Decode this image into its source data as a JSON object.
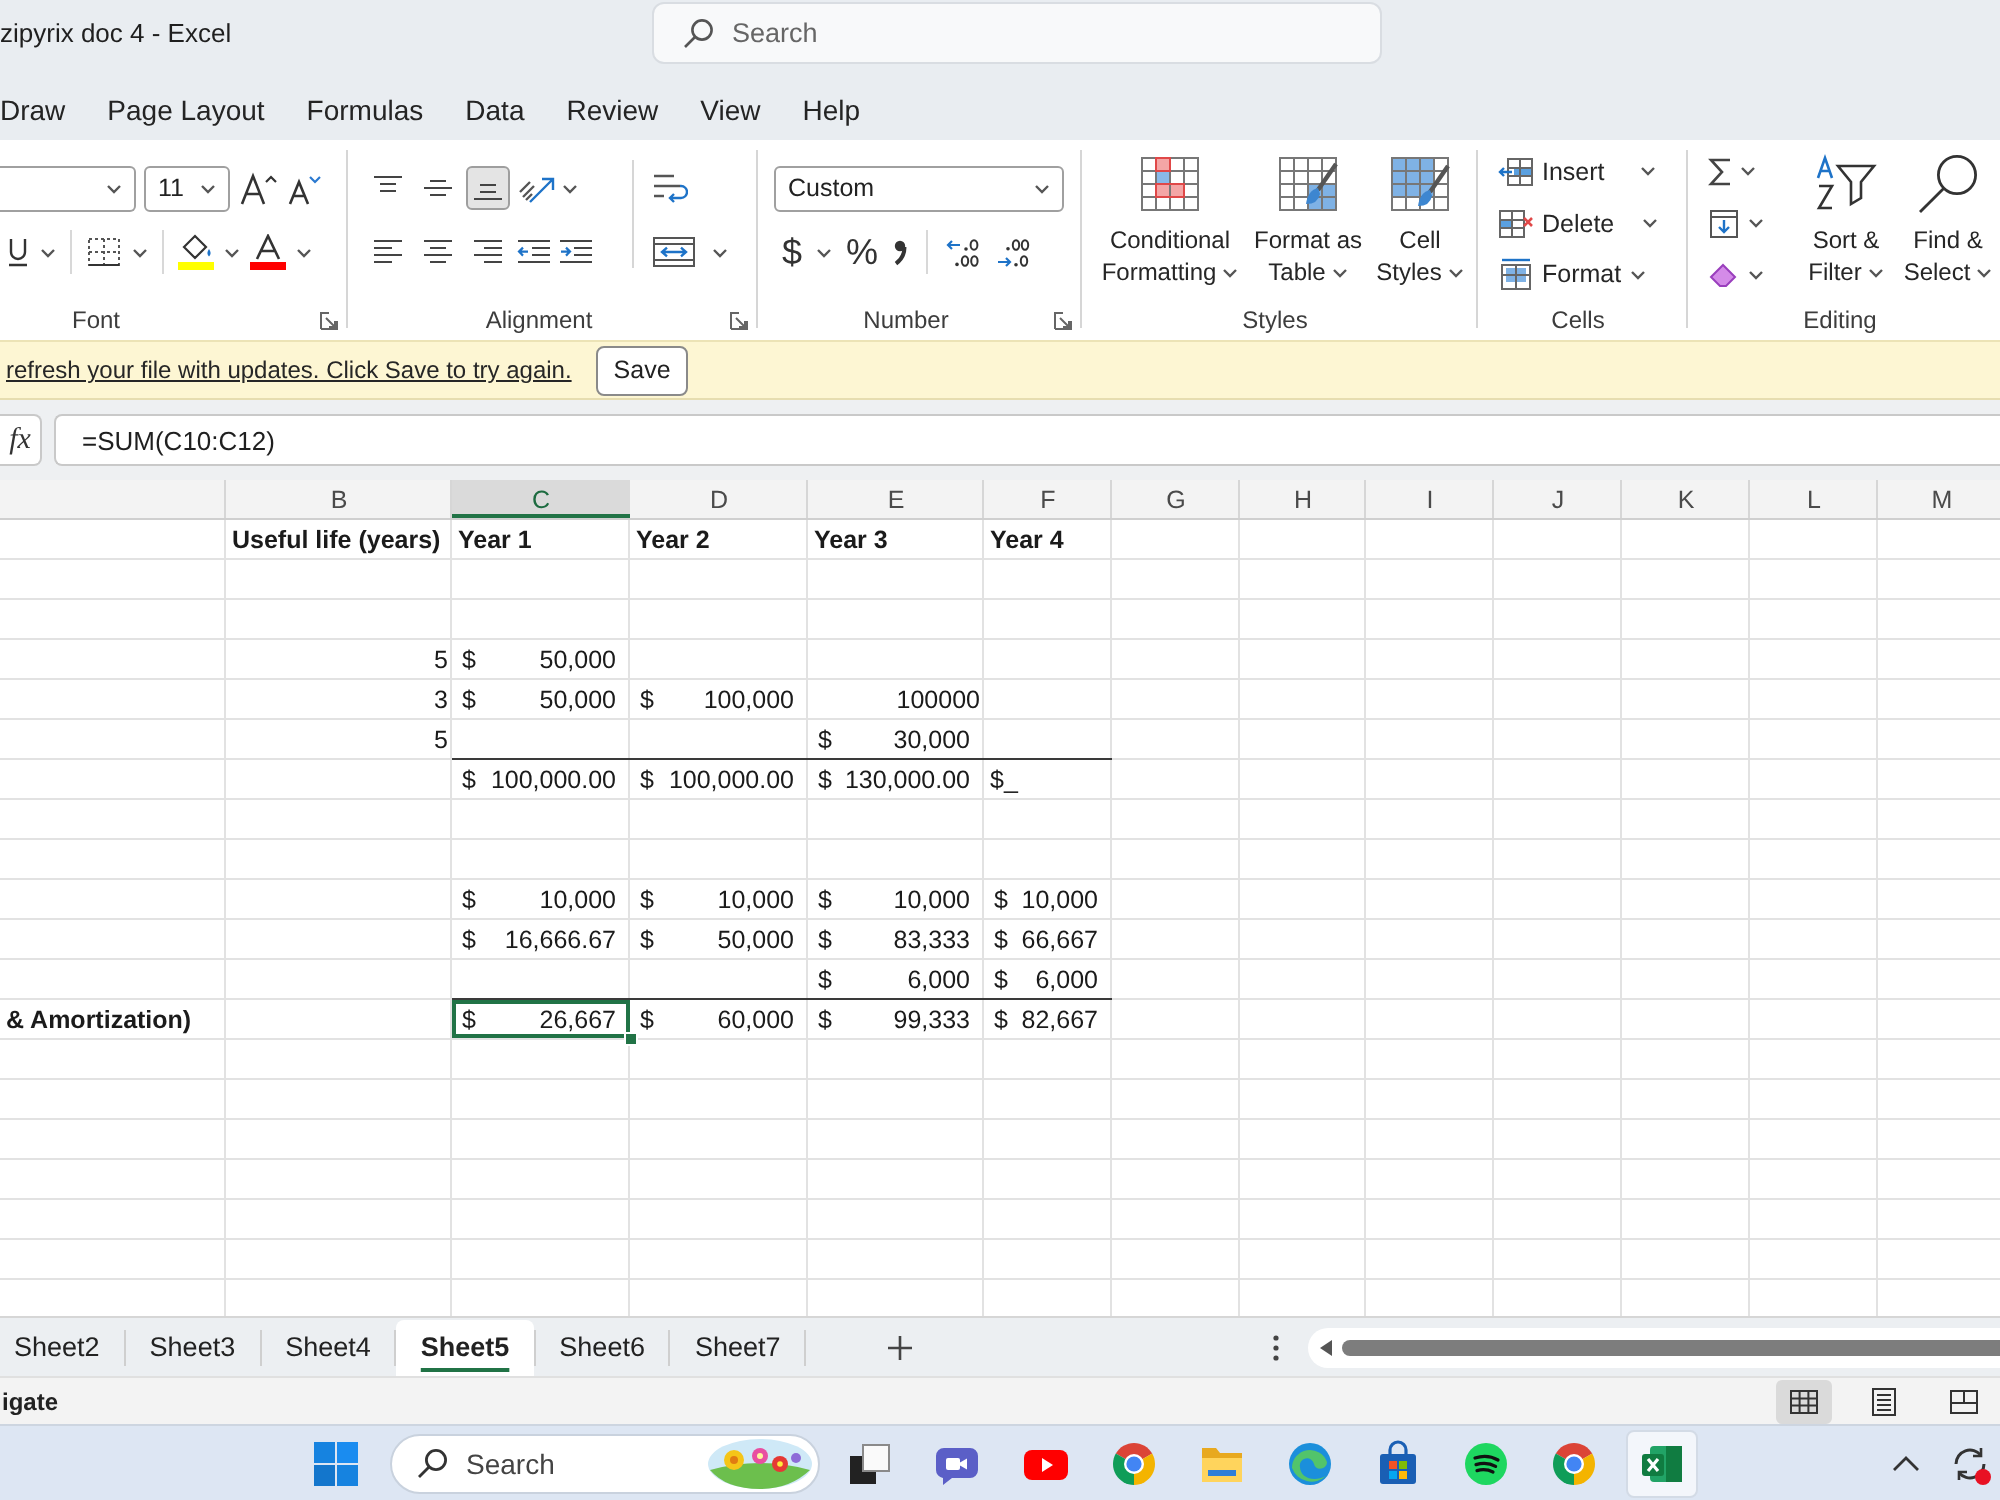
{
  "title_bar": {
    "title": "zipyrix doc 4 - Excel",
    "search": {
      "placeholder": "Search"
    }
  },
  "ribbon_tabs": [
    "Draw",
    "Page Layout",
    "Formulas",
    "Data",
    "Review",
    "View",
    "Help"
  ],
  "ribbon": {
    "font": {
      "label": "Font",
      "size": "11",
      "colors": [
        {
          "kind": "fill",
          "color": "#ffff00"
        },
        {
          "kind": "text",
          "color": "#ff0000"
        }
      ]
    },
    "alignment": {
      "label": "Alignment",
      "vertical": [
        {
          "kind": "top",
          "selected": false
        },
        {
          "kind": "middle",
          "selected": false
        },
        {
          "kind": "bottom",
          "selected": true
        }
      ],
      "horizontal": [
        {
          "kind": "left",
          "selected": false
        },
        {
          "kind": "center",
          "selected": false
        },
        {
          "kind": "right",
          "selected": false
        }
      ]
    },
    "number": {
      "label": "Number",
      "format": "Custom",
      "currency": "$",
      "percent": "%"
    },
    "styles": {
      "label": "Styles",
      "buttons": [
        {
          "kind": "conditional",
          "label": "Conditional Formatting"
        },
        {
          "kind": "table",
          "label": "Format as Table"
        },
        {
          "kind": "cell_styles",
          "label": "Cell Styles"
        }
      ]
    },
    "cells": {
      "label": "Cells",
      "buttons": [
        {
          "kind": "insert",
          "label": "Insert"
        },
        {
          "kind": "delete",
          "label": "Delete"
        },
        {
          "kind": "format",
          "label": "Format"
        }
      ]
    },
    "editing": {
      "label": "Editing",
      "buttons": [
        {
          "kind": "sort",
          "label": "Sort & Filter"
        },
        {
          "kind": "find",
          "label": "Find & Select"
        }
      ]
    }
  },
  "message_bar": {
    "text": "refresh your file with updates. Click Save to try again.",
    "button": "Save"
  },
  "formula_bar": {
    "function_button": "fx",
    "formula": "=SUM(C10:C12)"
  },
  "sheet": {
    "columns": [
      {
        "label": "B",
        "selected": false
      },
      {
        "label": "C",
        "selected": true
      },
      {
        "label": "D",
        "selected": false
      },
      {
        "label": "E",
        "selected": false
      },
      {
        "label": "F",
        "selected": false
      },
      {
        "label": "G",
        "selected": false
      },
      {
        "label": "H",
        "selected": false
      },
      {
        "label": "I",
        "selected": false
      },
      {
        "label": "J",
        "selected": false
      },
      {
        "label": "K",
        "selected": false
      },
      {
        "label": "L",
        "selected": false
      },
      {
        "label": "M",
        "selected": false
      }
    ],
    "rows": [
      {
        "rule_below": false,
        "cells": [
          {
            "selected": false
          },
          {
            "kind": "heading",
            "text": "Useful life (years)",
            "selected": false
          },
          {
            "kind": "heading",
            "text": "Year 1",
            "selected": false
          },
          {
            "kind": "heading",
            "text": "Year 2",
            "selected": false
          },
          {
            "kind": "heading",
            "text": "Year 3",
            "selected": false
          },
          {
            "kind": "heading",
            "text": "Year 4",
            "selected": false
          }
        ]
      },
      {
        "rule_below": false
      },
      {
        "rule_below": false
      },
      {
        "rule_below": false,
        "cells": [
          {
            "selected": false
          },
          {
            "kind": "number",
            "text": "5",
            "selected": false
          },
          {
            "kind": "accounting",
            "currency": "$",
            "amount": "50,000",
            "selected": false
          },
          {
            "selected": false
          },
          {
            "selected": false
          },
          {
            "selected": false
          }
        ]
      },
      {
        "rule_below": false,
        "cells": [
          {
            "selected": false
          },
          {
            "kind": "number",
            "text": "3",
            "selected": false
          },
          {
            "kind": "accounting",
            "currency": "$",
            "amount": "50,000",
            "selected": false
          },
          {
            "kind": "accounting",
            "currency": "$",
            "amount": "100,000",
            "selected": false
          },
          {
            "kind": "number",
            "text": "100000",
            "selected": false
          },
          {
            "selected": false
          }
        ]
      },
      {
        "rule_below": true,
        "cells": [
          {
            "selected": false
          },
          {
            "kind": "number",
            "text": "5",
            "selected": false
          },
          {
            "selected": false
          },
          {
            "selected": false
          },
          {
            "kind": "accounting",
            "currency": "$",
            "amount": "30,000",
            "selected": false
          },
          {
            "selected": false
          }
        ]
      },
      {
        "rule_below": false,
        "cells": [
          {
            "selected": false
          },
          {
            "selected": false
          },
          {
            "kind": "accounting",
            "currency": "$",
            "amount": "100,000.00",
            "selected": false
          },
          {
            "kind": "accounting",
            "currency": "$",
            "amount": "100,000.00",
            "selected": false
          },
          {
            "kind": "accounting",
            "currency": "$",
            "amount": "130,000.00",
            "selected": false
          },
          {
            "kind": "text",
            "text": "$_",
            "selected": false
          }
        ]
      },
      {
        "rule_below": false
      },
      {
        "rule_below": false
      },
      {
        "rule_below": false,
        "cells": [
          {
            "selected": false
          },
          {
            "selected": false
          },
          {
            "kind": "accounting",
            "currency": "$",
            "amount": "10,000",
            "selected": false
          },
          {
            "kind": "accounting",
            "currency": "$",
            "amount": "10,000",
            "selected": false
          },
          {
            "kind": "accounting",
            "currency": "$",
            "amount": "10,000",
            "selected": false
          },
          {
            "kind": "accounting",
            "currency": "$",
            "amount": "10,000",
            "selected": false
          }
        ]
      },
      {
        "rule_below": false,
        "cells": [
          {
            "selected": false
          },
          {
            "selected": false
          },
          {
            "kind": "accounting",
            "currency": "$",
            "amount": "16,666.67",
            "selected": false
          },
          {
            "kind": "accounting",
            "currency": "$",
            "amount": "50,000",
            "selected": false
          },
          {
            "kind": "accounting",
            "currency": "$",
            "amount": "83,333",
            "selected": false
          },
          {
            "kind": "accounting",
            "currency": "$",
            "amount": "66,667",
            "selected": false
          }
        ]
      },
      {
        "rule_below": true,
        "cells": [
          {
            "selected": false
          },
          {
            "selected": false
          },
          {
            "selected": false
          },
          {
            "selected": false
          },
          {
            "kind": "accounting",
            "currency": "$",
            "amount": "6,000",
            "selected": false
          },
          {
            "kind": "accounting",
            "currency": "$",
            "amount": "6,000",
            "selected": false
          }
        ]
      },
      {
        "rule_below": false,
        "cells": [
          {
            "kind": "heading",
            "text": "& Amortization)",
            "selected": false
          },
          {
            "selected": false
          },
          {
            "kind": "accounting",
            "currency": "$",
            "amount": "26,667",
            "selected": true
          },
          {
            "kind": "accounting",
            "currency": "$",
            "amount": "60,000",
            "selected": false
          },
          {
            "kind": "accounting",
            "currency": "$",
            "amount": "99,333",
            "selected": false
          },
          {
            "kind": "accounting",
            "currency": "$",
            "amount": "82,667",
            "selected": false
          }
        ]
      }
    ]
  },
  "sheet_tabs": [
    {
      "label": "Sheet2",
      "selected": false
    },
    {
      "label": "Sheet3",
      "selected": false
    },
    {
      "label": "Sheet4",
      "selected": false
    },
    {
      "label": "Sheet5",
      "selected": true
    },
    {
      "label": "Sheet6",
      "selected": false
    },
    {
      "label": "Sheet7",
      "selected": false
    }
  ],
  "status_bar": {
    "text": "igate",
    "views": [
      {
        "kind": "normal",
        "selected": true
      },
      {
        "kind": "page_layout",
        "selected": false
      },
      {
        "kind": "page_break",
        "selected": false
      }
    ]
  },
  "taskbar": {
    "search": {
      "placeholder": "Search"
    },
    "apps": [
      {
        "kind": "task_view",
        "selected": false
      },
      {
        "kind": "video_call",
        "selected": false
      },
      {
        "kind": "video_player",
        "selected": false
      },
      {
        "kind": "browser",
        "selected": false
      },
      {
        "kind": "files",
        "selected": false
      },
      {
        "kind": "browser_alt",
        "selected": false
      },
      {
        "kind": "store",
        "selected": false
      },
      {
        "kind": "music",
        "selected": false
      },
      {
        "kind": "browser",
        "selected": false
      },
      {
        "kind": "spreadsheet",
        "selected": true
      }
    ]
  }
}
